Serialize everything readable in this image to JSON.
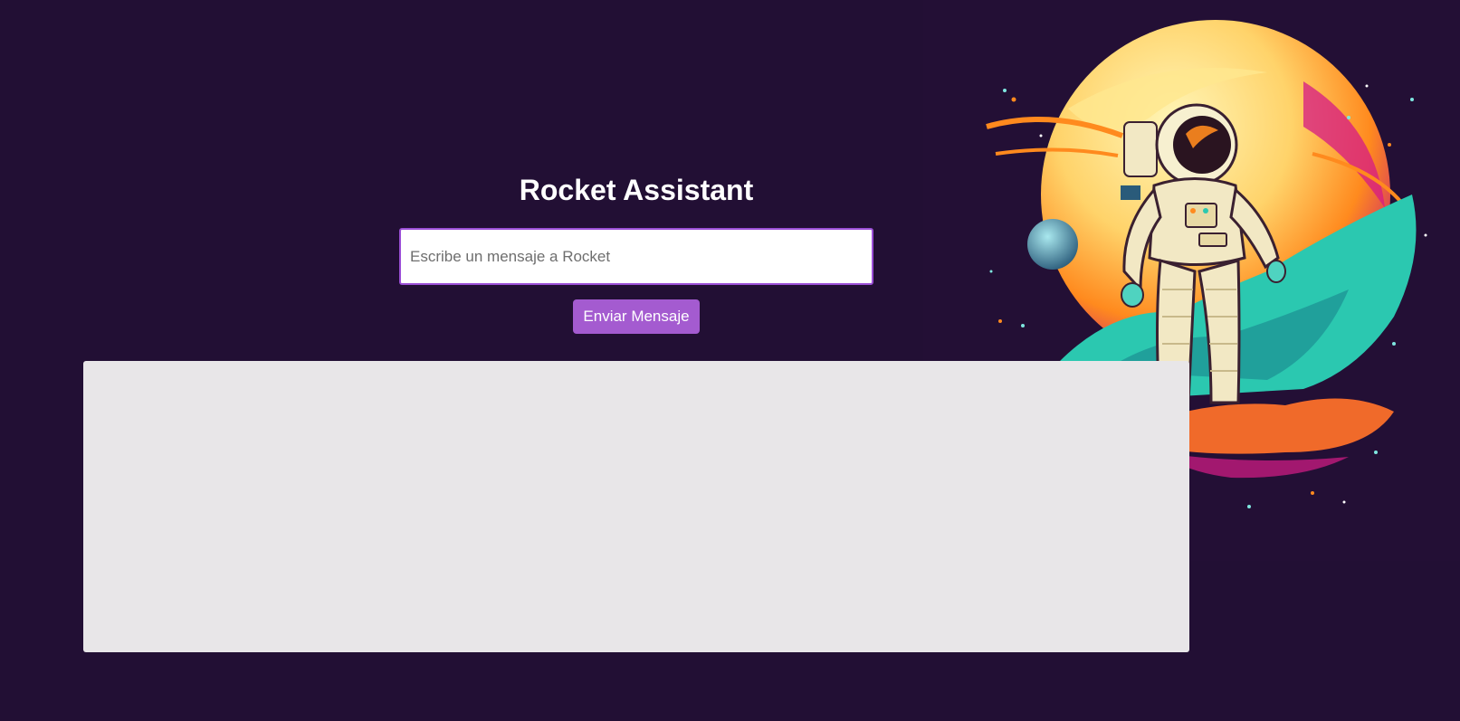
{
  "app": {
    "title": "Rocket Assistant"
  },
  "chat": {
    "input_value": "",
    "input_placeholder": "Escribe un mensaje a Rocket",
    "send_label": "Enviar Mensaje",
    "response_text": ""
  },
  "hero": {
    "illustration": "astronaut-on-planet"
  },
  "theme": {
    "background": "#220f34",
    "accent": "#a45bd0",
    "input_border": "#9b4fd6",
    "panel": "#e8e6e8",
    "title": "#ffffff"
  }
}
